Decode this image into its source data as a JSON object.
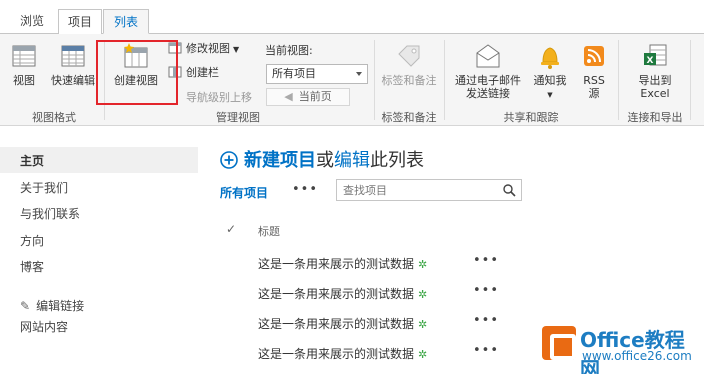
{
  "tabs": [
    {
      "label": "浏览"
    },
    {
      "label": "项目"
    },
    {
      "label": "列表"
    }
  ],
  "ribbon": {
    "view_format": {
      "label": "视图格式",
      "view_button": "视图",
      "quick_edit_button": "快速编辑"
    },
    "manage_views": {
      "label": "管理视图",
      "create_view_button": "创建视图",
      "modify_view": "修改视图",
      "create_column": "创建栏",
      "navigate_up": "导航级别上移",
      "current_view_label": "当前视图:",
      "current_view_value": "所有项目",
      "current_page": "当前页"
    },
    "tags_notes": {
      "label": "标签和备注",
      "button": "标签和备注"
    },
    "share_track": {
      "label": "共享和跟踪",
      "email_link_line1": "通过电子邮件",
      "email_link_line2": "发送链接",
      "alert_me": "通知我",
      "rss_line1": "RSS",
      "rss_line2": "源"
    },
    "connect_export": {
      "label": "连接和导出",
      "export_line1": "导出到",
      "export_line2": "Excel"
    }
  },
  "nav": {
    "items": [
      {
        "label": "主页"
      },
      {
        "label": "关于我们"
      },
      {
        "label": "与我们联系"
      },
      {
        "label": "方向"
      },
      {
        "label": "博客"
      }
    ],
    "edit_links": "编辑链接",
    "site_contents": "网站内容"
  },
  "main": {
    "title_new": "新建项目",
    "title_or": "或",
    "title_edit": "编辑",
    "title_rest": "此列表",
    "view_name": "所有项目",
    "more": "•••",
    "search_placeholder": "查找项目",
    "col_check": "✓",
    "col_title": "标题",
    "rows": [
      {
        "title": "这是一条用来展示的测试数据",
        "new_mark": "✲"
      },
      {
        "title": "这是一条用来展示的测试数据",
        "new_mark": "✲"
      },
      {
        "title": "这是一条用来展示的测试数据",
        "new_mark": "✲"
      },
      {
        "title": "这是一条用来展示的测试数据",
        "new_mark": "✲"
      }
    ]
  },
  "watermark": {
    "brand": "Office教程网",
    "url": "www.office26.com"
  },
  "colors": {
    "accent": "#0072c6",
    "highlight_box": "#e3252b",
    "new_mark": "#3aa543"
  }
}
